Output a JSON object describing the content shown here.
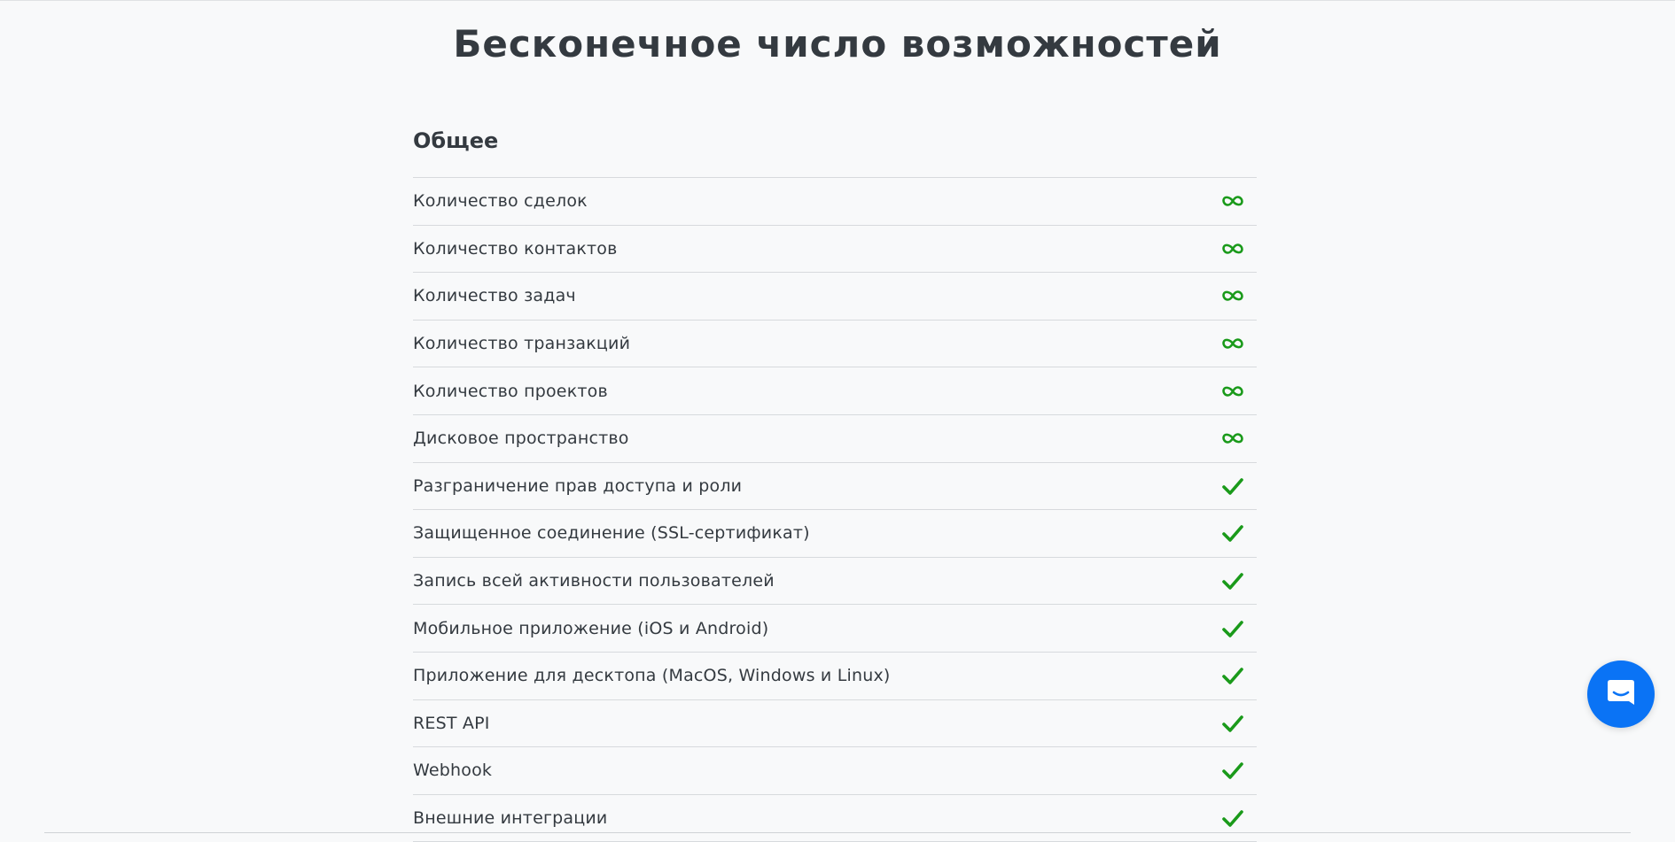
{
  "page": {
    "title": "Бесконечное число возможностей"
  },
  "section": {
    "title": "Общее",
    "rows": [
      {
        "label": "Количество сделок",
        "icon": "infinity-icon"
      },
      {
        "label": "Количество контактов",
        "icon": "infinity-icon"
      },
      {
        "label": "Количество задач",
        "icon": "infinity-icon"
      },
      {
        "label": "Количество транзакций",
        "icon": "infinity-icon"
      },
      {
        "label": "Количество проектов",
        "icon": "infinity-icon"
      },
      {
        "label": "Дисковое пространство",
        "icon": "infinity-icon"
      },
      {
        "label": "Разграничение прав доступа и роли",
        "icon": "check-icon"
      },
      {
        "label": "Защищенное соединение (SSL-сертификат)",
        "icon": "check-icon"
      },
      {
        "label": "Запись всей активности пользователей",
        "icon": "check-icon"
      },
      {
        "label": "Мобильное приложение (iOS и Android)",
        "icon": "check-icon"
      },
      {
        "label": "Приложение для десктопа (MacOS, Windows и Linux)",
        "icon": "check-icon"
      },
      {
        "label": "REST API",
        "icon": "check-icon"
      },
      {
        "label": "Webhook",
        "icon": "check-icon"
      },
      {
        "label": "Внешние интеграции",
        "icon": "check-icon"
      }
    ]
  },
  "chat": {
    "icon": "chat-bubble-icon"
  },
  "colors": {
    "accent_green": "#1a9a1a",
    "chat_blue": "#0a73f5",
    "text": "#343a40",
    "divider": "#d7dadd",
    "background": "#f8f9fa"
  }
}
